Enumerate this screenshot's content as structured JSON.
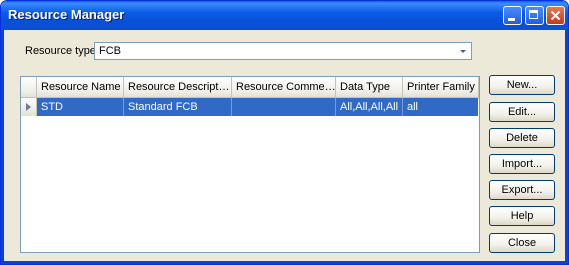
{
  "window": {
    "title": "Resource Manager"
  },
  "resource_type": {
    "label": "Resource type:",
    "value": "FCB"
  },
  "table": {
    "columns": [
      "Resource Name",
      "Resource Descript…",
      "Resource Comme…",
      "Data Type",
      "Printer Family"
    ],
    "rows": [
      {
        "name": "STD",
        "description": "Standard FCB",
        "comment": "",
        "data_type": "All,All,All,All",
        "printer_family": "all"
      }
    ]
  },
  "buttons": {
    "new": "New...",
    "edit": "Edit...",
    "delete": "Delete",
    "import": "Import...",
    "export": "Export...",
    "help": "Help",
    "close": "Close"
  },
  "colors": {
    "titlebar": "#0a5ce8",
    "selection": "#316ac5",
    "face": "#ece9d8"
  }
}
